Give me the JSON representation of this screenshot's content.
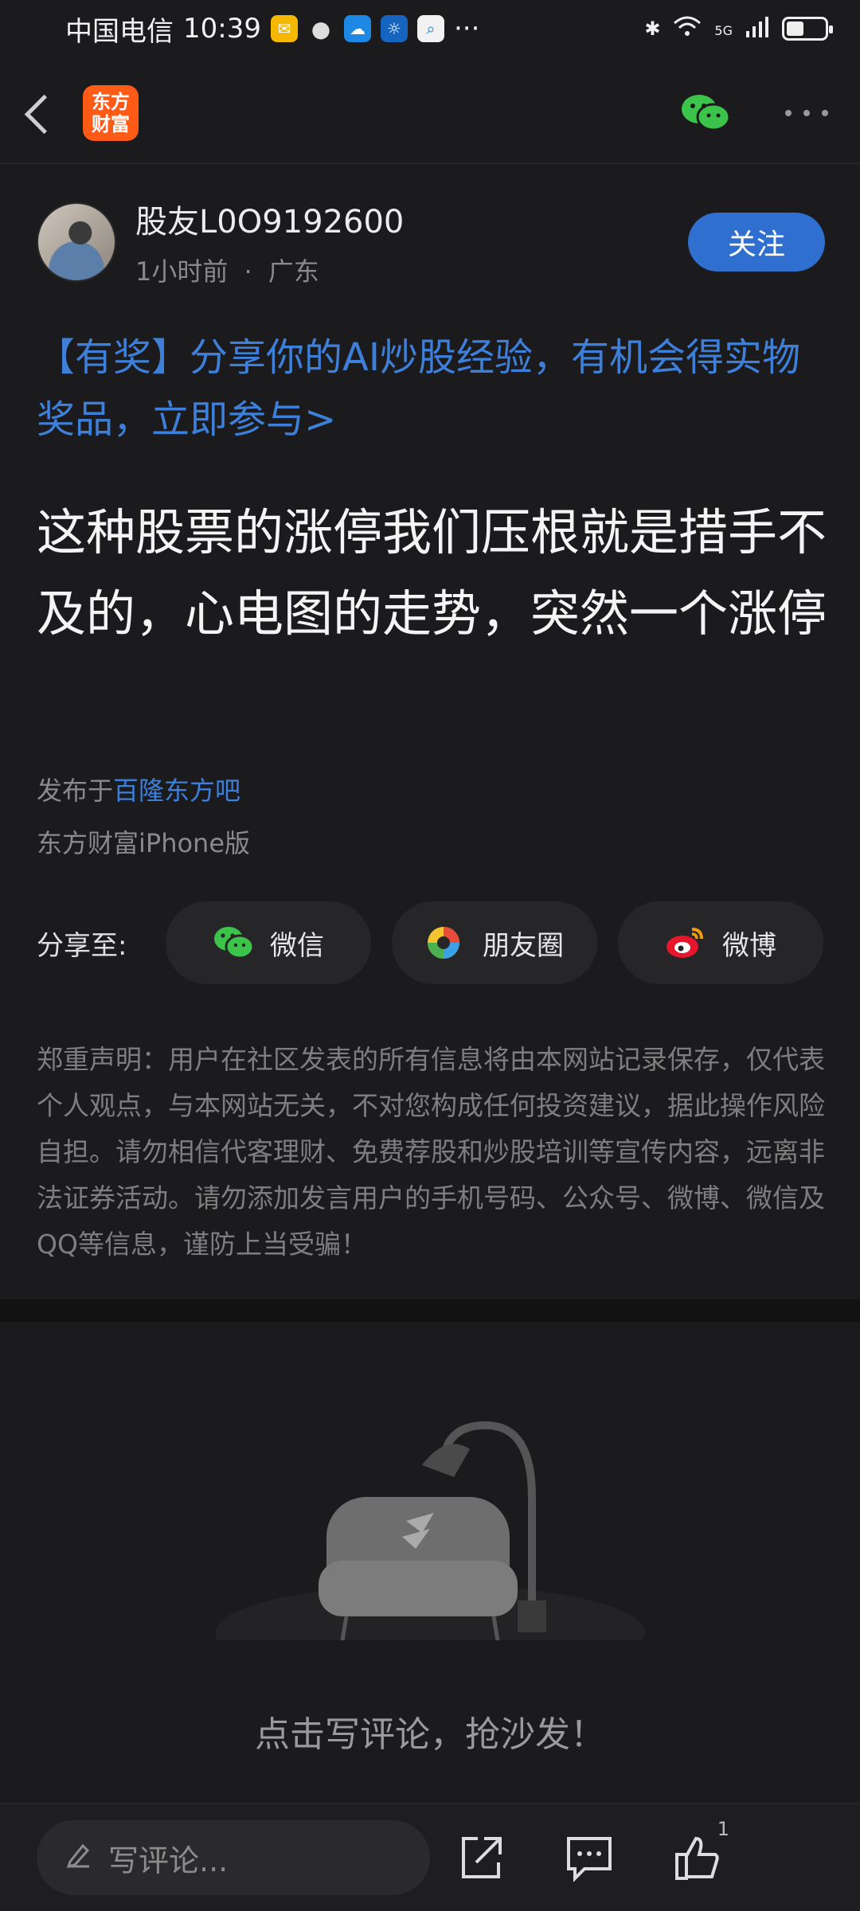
{
  "status_bar": {
    "carrier": "中国电信",
    "time": "10:39",
    "overflow": "···",
    "network": "5G"
  },
  "header": {
    "logo_line1": "东方",
    "logo_line2": "财富"
  },
  "author": {
    "name": "股友L0O9192600",
    "time_ago": "1小时前",
    "separator": "·",
    "location": "广东",
    "follow_label": "关注"
  },
  "promo_text": "【有奖】分享你的AI炒股经验，有机会得实物奖品，立即参与>",
  "post_title": "这种股票的涨停我们压根就是措手不及的，心电图的走势，突然一个涨停",
  "source": {
    "prefix": "发布于",
    "bar_name": "百隆东方吧",
    "platform": "东方财富iPhone版"
  },
  "share": {
    "label": "分享至:",
    "options": [
      {
        "label": "微信",
        "icon": "wechat-icon"
      },
      {
        "label": "朋友圈",
        "icon": "moments-icon"
      },
      {
        "label": "微博",
        "icon": "weibo-icon"
      }
    ]
  },
  "disclaimer": "郑重声明：用户在社区发表的所有信息将由本网站记录保存，仅代表个人观点，与本网站无关，不对您构成任何投资建议，据此操作风险自担。请勿相信代客理财、免费荐股和炒股培训等宣传内容，远离非法证券活动。请勿添加发言用户的手机号码、公众号、微博、微信及QQ等信息，谨防上当受骗！",
  "empty_comments": "点击写评论，抢沙发！",
  "bottom_bar": {
    "comment_placeholder": "写评论...",
    "like_count": "1"
  },
  "colors": {
    "accent": "#2f6fcf",
    "link": "#3d7fd9",
    "background": "#1b1b1d",
    "brand_logo": "#ff5a16"
  }
}
